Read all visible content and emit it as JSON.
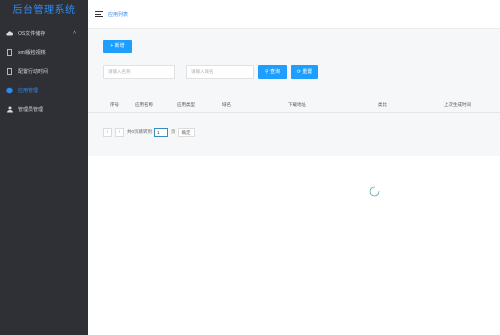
{
  "app": {
    "title": "后台管理系统"
  },
  "sidebar": {
    "items": [
      {
        "label": "OS文件储存",
        "icon": "cloud-icon",
        "active": false,
        "chevron": "˄"
      },
      {
        "label": "xml版检视核",
        "icon": "file-icon",
        "active": false
      },
      {
        "label": "配置行动时间",
        "icon": "file-icon",
        "active": false
      },
      {
        "label": "应用管理",
        "icon": "cube-icon",
        "active": true
      },
      {
        "label": "管理员管理",
        "icon": "user-icon",
        "active": false
      }
    ]
  },
  "header": {
    "breadcrumb": "应用列表"
  },
  "toolbar": {
    "add_label": "+ 新增",
    "app_name_placeholder": "请输入名称",
    "domain_placeholder": "请输入域名",
    "search_label": "查询",
    "reset_label": "重置"
  },
  "table": {
    "columns": [
      "序号",
      "应用名称",
      "应用类型",
      "域名",
      "下载地址",
      "类比",
      "上次生成时间"
    ]
  },
  "pager": {
    "prev": "‹",
    "next": "›",
    "goto_label": "共0页跳转到",
    "page_value": "1",
    "page_unit": "页",
    "confirm_label": "确定"
  },
  "colors": {
    "sidebar_bg": "#2f3035",
    "accent": "#1e9fff",
    "brand": "#2d8cf0",
    "content_bg": "#f6f7f8"
  }
}
